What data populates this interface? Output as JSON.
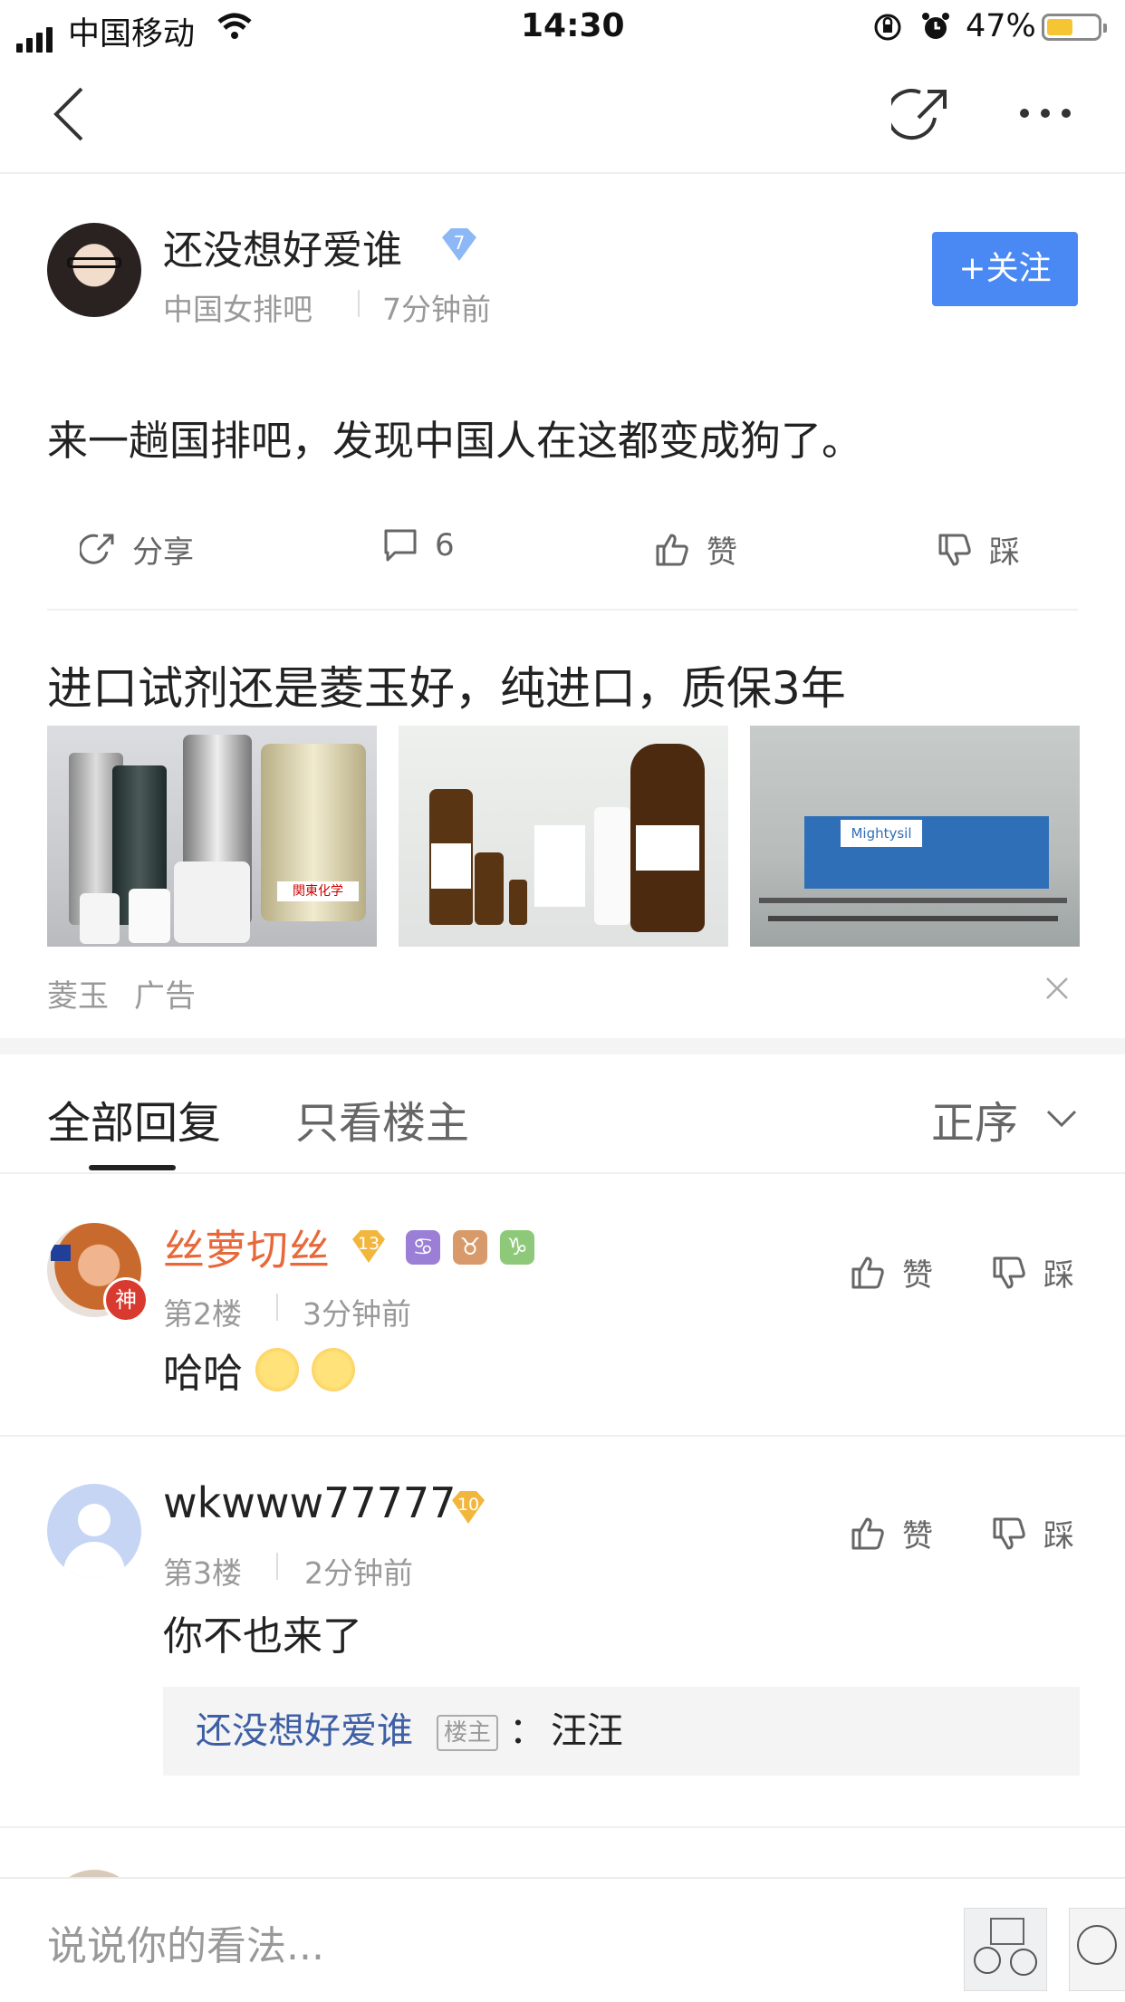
{
  "status_bar": {
    "carrier": "中国移动",
    "time": "14:30",
    "battery": "47%"
  },
  "post": {
    "author": "还没想好爱谁",
    "level": "7",
    "forum": "中国女排吧",
    "time": "7分钟前",
    "follow_label": "+关注",
    "content": "来一趟国排吧，发现中国人在这都变成狗了。",
    "actions": {
      "share": "分享",
      "comment": "6",
      "like": "赞",
      "dislike": "踩"
    }
  },
  "ad": {
    "title": "进口试剂还是菱玉好，纯进口，质保3年",
    "brand": "菱玉",
    "tag": "广告",
    "image_labels": [
      "関東化学",
      "Mightysil"
    ]
  },
  "tabs": {
    "all": "全部回复",
    "op_only": "只看楼主",
    "sort": "正序"
  },
  "replies": [
    {
      "name": "丝萝切丝",
      "level": "13",
      "avatar_badge": "神",
      "zodiac": [
        "♋",
        "♉",
        "♑"
      ],
      "floor": "第2楼",
      "time": "3分钟前",
      "content": "哈哈",
      "like": "赞",
      "dislike": "踩"
    },
    {
      "name": "wkwww77777",
      "level": "10",
      "floor": "第3楼",
      "time": "2分钟前",
      "content": "你不也来了",
      "like": "赞",
      "dislike": "踩",
      "sub_reply": {
        "name": "还没想好爱谁",
        "tag": "楼主",
        "colon": "：",
        "content": "汪汪"
      }
    }
  ],
  "composer": {
    "placeholder": "说说你的看法..."
  },
  "colors": {
    "accent": "#4a89f3",
    "orange_name": "#e8683a",
    "link_blue": "#3e5fa6"
  }
}
